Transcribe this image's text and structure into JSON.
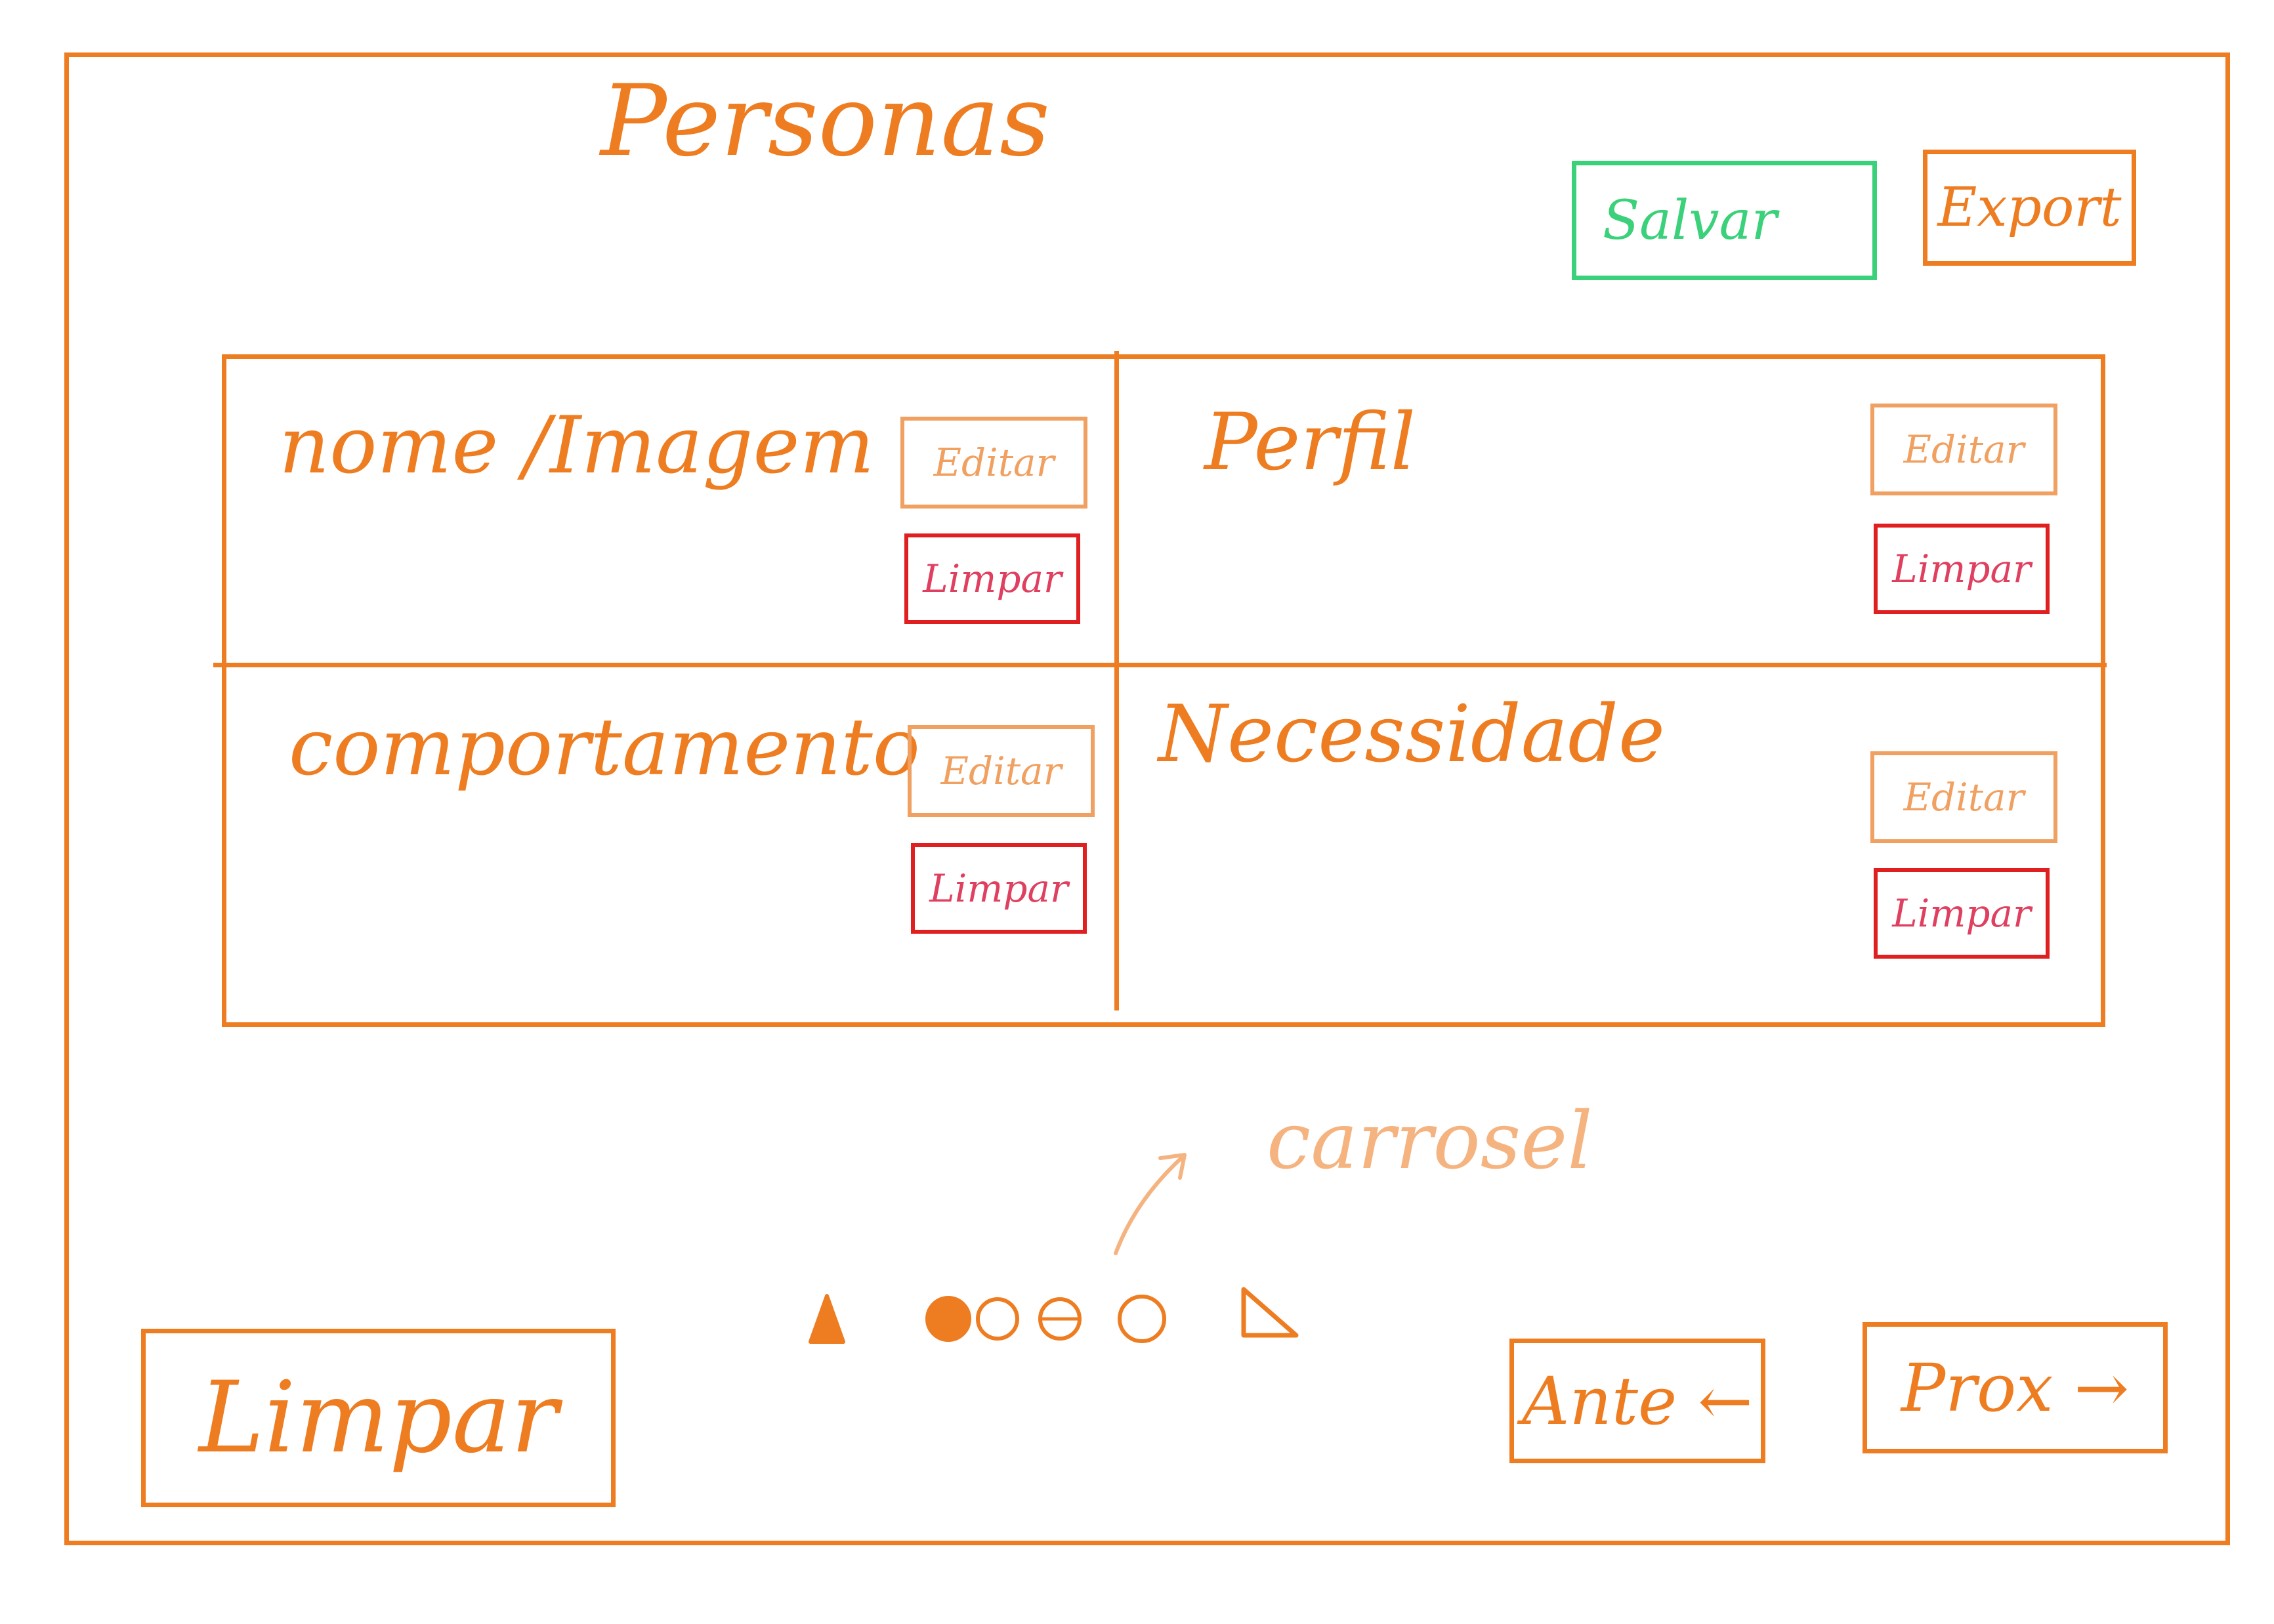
{
  "header": {
    "title": "Personas",
    "save_label": "Salvar",
    "export_label": "Export"
  },
  "quadrants": [
    {
      "label": "nome /Imagem",
      "edit_label": "Editar",
      "clear_label": "Limpar"
    },
    {
      "label": "Perfil",
      "edit_label": "Editar",
      "clear_label": "Limpar"
    },
    {
      "label": "comportamento",
      "edit_label": "Editar",
      "clear_label": "Limpar"
    },
    {
      "label": "Necessidade",
      "edit_label": "Editar",
      "clear_label": "Limpar"
    }
  ],
  "annotation": {
    "carousel_note": "carrosel"
  },
  "carousel": {
    "total_dots": 4,
    "active_index": 0
  },
  "footer": {
    "clear_all_label": "Limpar",
    "prev_label": "Ante ←",
    "next_label": "Prox →"
  },
  "colors": {
    "ink": "#ee7d22",
    "save": "#3bd17a",
    "clear": "#e02020",
    "edit": "#f0a060"
  }
}
